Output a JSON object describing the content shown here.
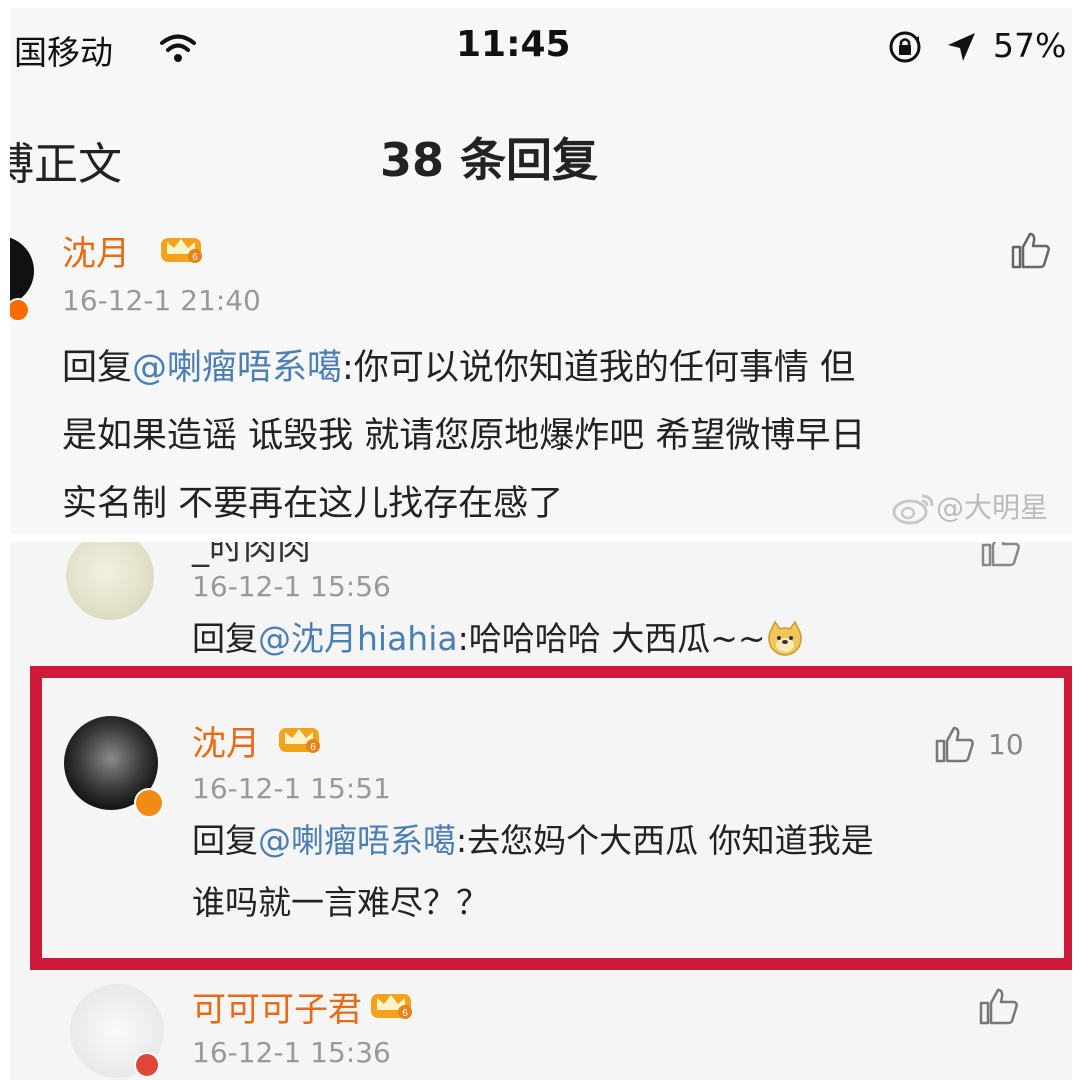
{
  "status_bar": {
    "carrier": "国移动",
    "time": "11:45",
    "battery": "57%"
  },
  "nav": {
    "back_label": "博正文",
    "title": "38 条回复"
  },
  "comments": [
    {
      "username": "沈月",
      "timestamp": "16-12-1 21:40",
      "prefix": "回复",
      "mention": "@喇瘤唔系噶",
      "lines": [
        ":你可以说你知道我的任何事情 但",
        "是如果造谣 诋毁我 就请您原地爆炸吧 希望微博早日",
        "实名制 不要再在这儿找存在感了"
      ]
    },
    {
      "username": "_时肉肉",
      "timestamp": "16-12-1 15:56",
      "prefix": "回复",
      "mention": "@沈月hiahia",
      "text": ":哈哈哈哈  大西瓜~~"
    },
    {
      "username": "沈月",
      "timestamp": "16-12-1 15:51",
      "likes": "10",
      "prefix": "回复",
      "mention": "@喇瘤唔系噶",
      "lines": [
        ":去您妈个大西瓜 你知道我是",
        "谁吗就一言难尽？？"
      ]
    },
    {
      "username": "可可可子君",
      "timestamp": "16-12-1 15:36"
    }
  ],
  "watermark": "@大明星",
  "colors": {
    "username": "#e86a14",
    "mention": "#4a7fb5",
    "highlight_border": "#d01a3a",
    "timestamp": "#999999"
  },
  "icons": [
    "wifi-icon",
    "lock-rotation-icon",
    "location-arrow-icon",
    "crown-vip-icon",
    "thumbs-up-icon",
    "weibo-logo-icon",
    "doge-emoji-icon"
  ]
}
